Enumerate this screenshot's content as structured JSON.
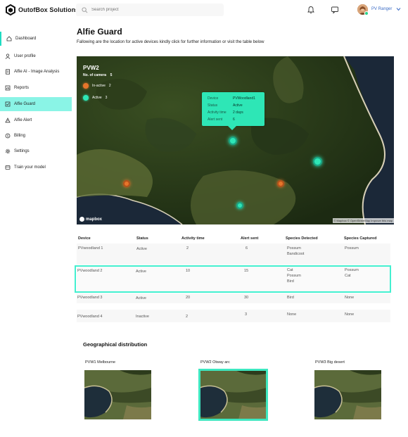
{
  "app": {
    "brand": "OutofBox Solutions",
    "search_placeholder": "Search project",
    "user_name": "PV Ranger"
  },
  "sidebar": {
    "items": [
      {
        "label": "Dashboard",
        "icon": "home-icon"
      },
      {
        "label": "User profile",
        "icon": "user-icon"
      },
      {
        "label": "Alfie AI - Image Analysis",
        "icon": "document-icon"
      },
      {
        "label": "Reports",
        "icon": "report-icon"
      },
      {
        "label": "Alfie Guard",
        "icon": "guard-icon",
        "active": true
      },
      {
        "label": "Alfie Alert",
        "icon": "alert-icon"
      },
      {
        "label": "Billing",
        "icon": "billing-icon"
      },
      {
        "label": "Settings",
        "icon": "gear-icon"
      },
      {
        "label": "Train your model",
        "icon": "train-icon"
      }
    ]
  },
  "page": {
    "title": "Alfie Guard",
    "subtitle": "Fallowing are the location for active devices kindly click for further information or visit the table below"
  },
  "map": {
    "title": "PVW2",
    "camera_label": "No. of camera",
    "camera_count": "5",
    "legend": [
      {
        "label": "In-active",
        "count": "2",
        "color": "#e6752b"
      },
      {
        "label": "Active",
        "count": "3",
        "color": "#2ee6b6"
      }
    ],
    "tooltip": {
      "rows": [
        {
          "key": "Device",
          "value": "PVWoodland1"
        },
        {
          "key": "Status",
          "value": "Active"
        },
        {
          "key": "Activity time",
          "value": "2 days"
        },
        {
          "key": "Alert sent",
          "value": "6"
        }
      ]
    },
    "attribution_logo": "mapbox",
    "attribution_text": "© Mapbox © OpenStreetMap  Improve this map"
  },
  "table": {
    "headers": [
      "Device",
      "Status",
      "Activity time",
      "Alert sent",
      "Species Detected",
      "Species Captured"
    ],
    "rows": [
      {
        "device": "PVwoodland 1",
        "status": "Active",
        "activity": "2",
        "alerts": "6",
        "detected": [
          "Possum",
          "Bandicoot"
        ],
        "captured": [
          "Possum"
        ]
      },
      {
        "device": "PVwoodland 2",
        "status": "Active",
        "activity": "10",
        "alerts": "15",
        "detected": [
          "Cat",
          "Possum",
          "Bird"
        ],
        "captured": [
          "Possum",
          "Cat"
        ]
      },
      {
        "device": "PVwoodland 3",
        "status": "Active",
        "activity": "20",
        "alerts": "30",
        "detected": [
          "Bird"
        ],
        "captured": [
          "None"
        ]
      },
      {
        "device": "PVwoodland 4",
        "status": "Inactive",
        "activity": "2",
        "alerts": "3",
        "detected": [
          "None"
        ],
        "captured": [
          "None"
        ]
      }
    ]
  },
  "geo": {
    "title": "Geographical distribution",
    "regions": [
      {
        "label": "PVW1 Melbourne"
      },
      {
        "label": "PVW2 Otway arc",
        "selected": true
      },
      {
        "label": "PVW3 Big desert"
      }
    ]
  },
  "colors": {
    "accent": "#2ee6b6",
    "sidebar_active": "#8af4e6",
    "highlight_border": "#44f0d0",
    "inactive_marker": "#e6752b"
  }
}
